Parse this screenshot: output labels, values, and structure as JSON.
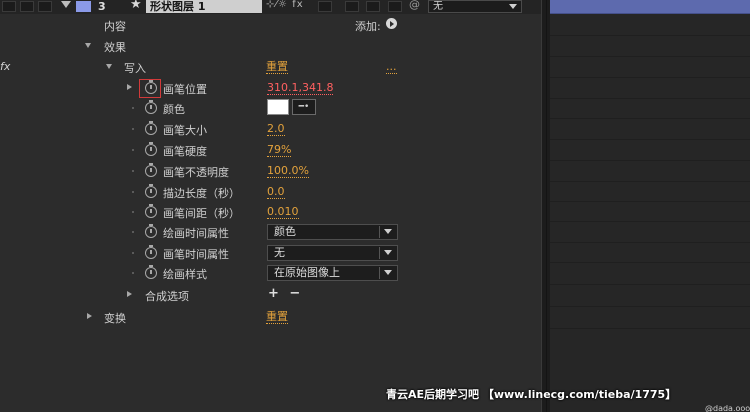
{
  "layer": {
    "number": "3",
    "name": "形状图层 1",
    "switch_icons": "⊹⁄☼ fx",
    "parent": "无"
  },
  "rows": {
    "content": {
      "label": "内容",
      "add_label": "添加:"
    },
    "effects": {
      "label": "效果"
    },
    "write_on": {
      "label": "写入",
      "reset": "重置",
      "options": "..."
    },
    "brush_position": {
      "label": "画笔位置",
      "value": "310.1,341.8"
    },
    "color": {
      "label": "颜色",
      "swatch": "#ffffff"
    },
    "brush_size": {
      "label": "画笔大小",
      "value": "2.0"
    },
    "brush_hardness": {
      "label": "画笔硬度",
      "value": "79%"
    },
    "brush_opacity": {
      "label": "画笔不透明度",
      "value": "100.0%"
    },
    "stroke_length": {
      "label": "描边长度（秒）",
      "value": "0.0"
    },
    "brush_spacing": {
      "label": "画笔间距（秒）",
      "value": "0.010"
    },
    "paint_time_props": {
      "label": "绘画时间属性",
      "selected": "颜色"
    },
    "brush_time_props": {
      "label": "画笔时间属性",
      "selected": "无"
    },
    "paint_style": {
      "label": "绘画样式",
      "selected": "在原始图像上"
    },
    "compositing_options": {
      "label": "合成选项",
      "controls": "+ −"
    },
    "transform": {
      "label": "变换",
      "reset": "重置"
    }
  },
  "edge_fx": "fx",
  "watermark": "青云AE后期学习吧 【www.linecg.com/tieba/1775】",
  "corner_text": "@dada.oooo",
  "colors": {
    "accent_value": "#e3a23c",
    "highlight_value": "#ff6060",
    "time_bar": "#5d6aae",
    "layer_label": "#8b9ae8"
  }
}
